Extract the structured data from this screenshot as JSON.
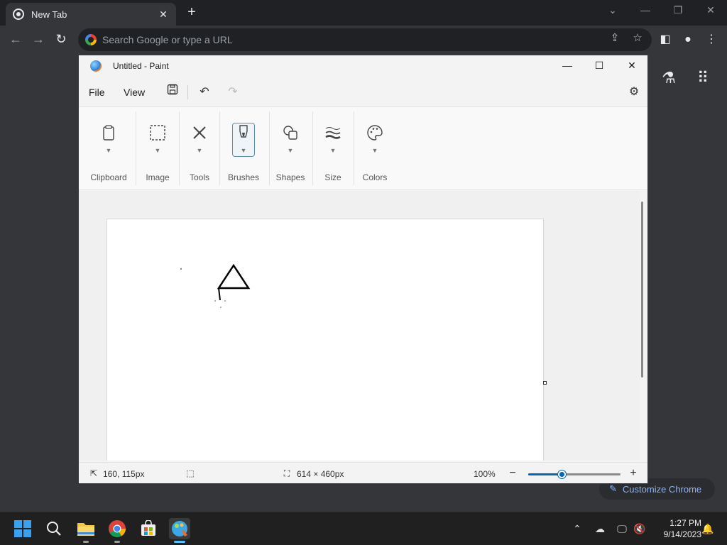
{
  "chrome": {
    "tab_title": "New Tab",
    "tab_close": "✕",
    "new_tab": "+",
    "omnibox_placeholder": "Search Google or type a URL",
    "customize_label": "Customize Chrome",
    "controls": {
      "chevron": "⌄",
      "minimize": "—",
      "restore": "❐",
      "close": "✕"
    }
  },
  "paint": {
    "title": "Untitled - Paint",
    "menu": {
      "file": "File",
      "view": "View"
    },
    "ribbon": [
      {
        "label": "Clipboard",
        "icon": "clipboard-icon"
      },
      {
        "label": "Image",
        "icon": "select-icon"
      },
      {
        "label": "Tools",
        "icon": "tools-icon"
      },
      {
        "label": "Brushes",
        "icon": "brush-icon"
      },
      {
        "label": "Shapes",
        "icon": "shapes-icon"
      },
      {
        "label": "Size",
        "icon": "size-icon"
      },
      {
        "label": "Colors",
        "icon": "palette-icon"
      }
    ],
    "status": {
      "cursor_position": "160, 115px",
      "canvas_size": "614 × 460px",
      "zoom": "100%",
      "zoom_fraction": 0.38
    }
  },
  "taskbar": {
    "time": "1:27 PM",
    "date": "9/14/2023"
  },
  "colors": {
    "chrome_frame": "#202124",
    "chrome_bg": "#35363a",
    "paint_accent": "#0067c0",
    "taskbar_accent": "#4cc2ff"
  }
}
